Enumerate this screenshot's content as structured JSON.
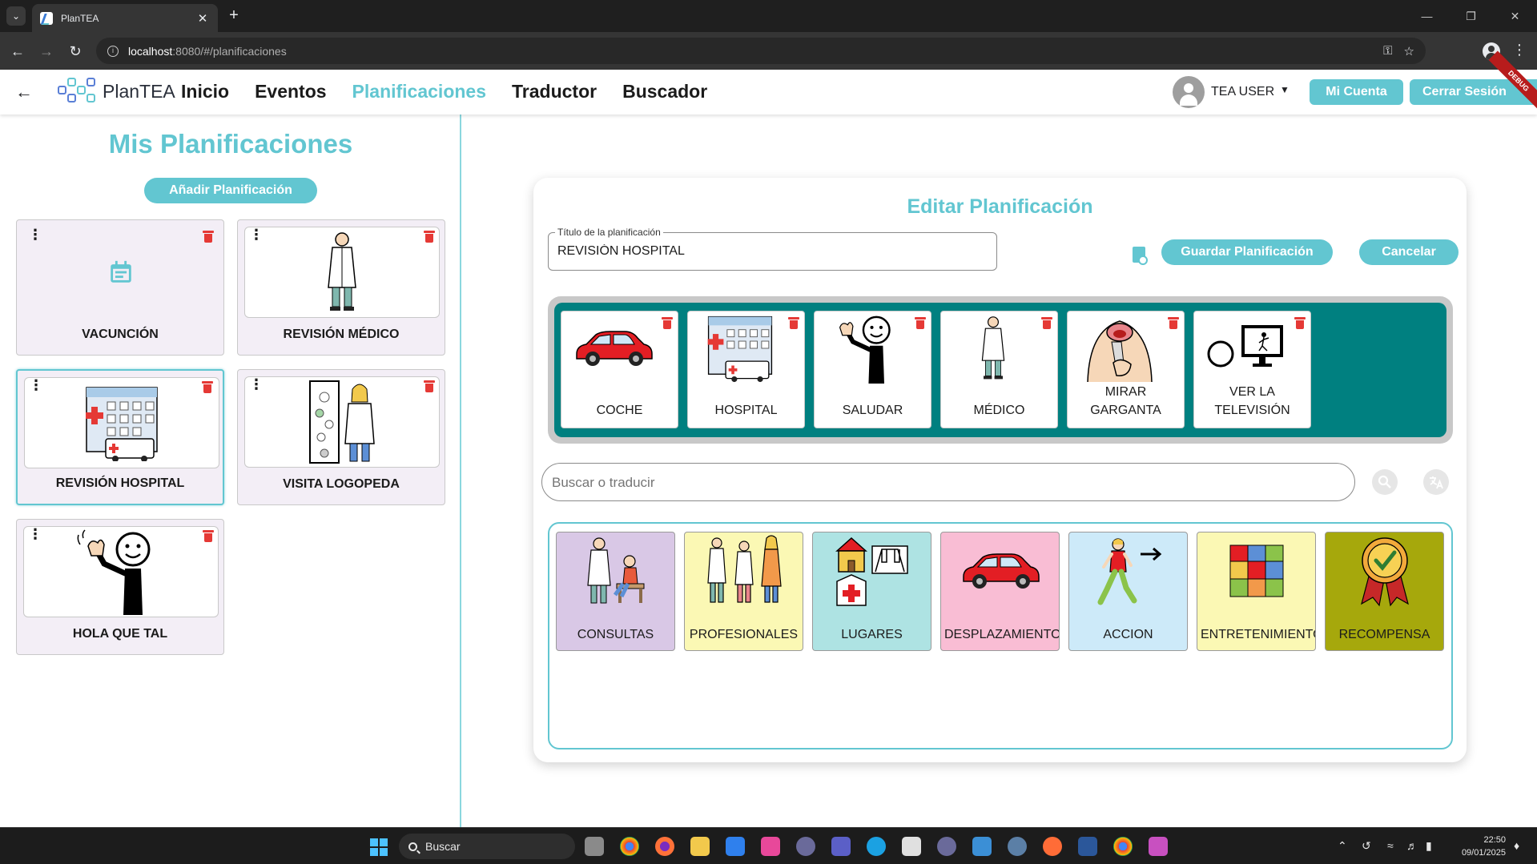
{
  "browser": {
    "tab_title": "PlanTEA",
    "url_host": "localhost",
    "url_path": ":8080/#/planificaciones"
  },
  "appbar": {
    "brand": "PlanTEA",
    "nav": [
      "Inicio",
      "Eventos",
      "Planificaciones",
      "Traductor",
      "Buscador"
    ],
    "active_nav": "Planificaciones",
    "user_name": "TEA USER",
    "mi_cuenta_label": "Mi Cuenta",
    "cerrar_sesion_label": "Cerrar Sesión",
    "debug_label": "DEBUG"
  },
  "left_panel": {
    "title": "Mis Planificaciones",
    "add_label": "Añadir Planificación",
    "plans": [
      {
        "label": "VACUNCIÓN",
        "icon": "calendar-icon"
      },
      {
        "label": "REVISIÓN MÉDICO",
        "icon": "doctor-pictogram"
      },
      {
        "label": "REVISIÓN HOSPITAL",
        "icon": "hospital-pictogram",
        "selected": true
      },
      {
        "label": "VISITA LOGOPEDA",
        "icon": "speech-therapist-pictogram"
      },
      {
        "label": "HOLA QUE TAL",
        "icon": "waving-person-pictogram"
      }
    ]
  },
  "editor": {
    "title": "Editar Planificación",
    "title_field_label": "Título de la planificación",
    "title_field_value": "REVISIÓN HOSPITAL",
    "save_label": "Guardar Planificación",
    "cancel_label": "Cancelar",
    "sequence": [
      {
        "label": "COCHE",
        "icon": "car-pictogram"
      },
      {
        "label": "HOSPITAL",
        "icon": "hospital-pictogram"
      },
      {
        "label": "SALUDAR",
        "icon": "waving-person-pictogram"
      },
      {
        "label": "MÉDICO",
        "icon": "doctor-pictogram"
      },
      {
        "label": "MIRAR GARGANTA",
        "icon": "throat-pictogram"
      },
      {
        "label": "VER LA TELEVISIÓN",
        "icon": "tv-pictogram"
      }
    ],
    "search_placeholder": "Buscar o traducir",
    "categories": [
      {
        "label": "CONSULTAS",
        "color": "#d9c8e6",
        "icon": "consultation-pictogram"
      },
      {
        "label": "PROFESIONALES",
        "color": "#fbf8b4",
        "icon": "professionals-pictogram"
      },
      {
        "label": "LUGARES",
        "color": "#aee3e3",
        "icon": "places-pictogram"
      },
      {
        "label": "DESPLAZAMIENTO",
        "color": "#f9bdd4",
        "icon": "car-pictogram"
      },
      {
        "label": "ACCION",
        "color": "#cdeaf9",
        "icon": "walking-person-pictogram"
      },
      {
        "label": "ENTRETENIMIENTO",
        "color": "#fbf8b4",
        "icon": "puzzle-pictogram"
      },
      {
        "label": "RECOMPENSA",
        "color": "#a6a80c",
        "icon": "medal-pictogram"
      }
    ]
  },
  "taskbar": {
    "search_label": "Buscar",
    "time": "22:50",
    "date": "09/01/2025"
  },
  "colors": {
    "accent": "#62c6d1",
    "sequence_bg": "#008080",
    "danger": "#e53935"
  }
}
